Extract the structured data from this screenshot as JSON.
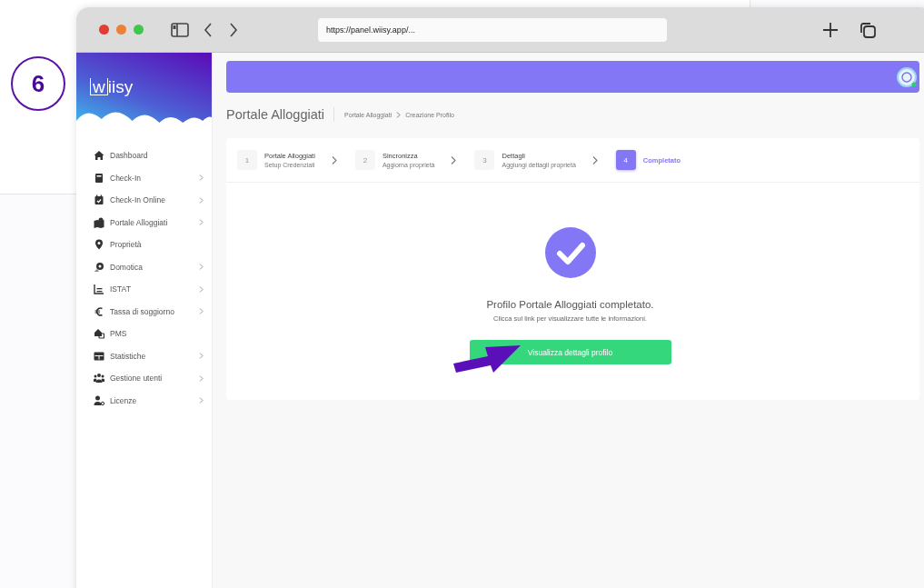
{
  "step_badge": "6",
  "browser": {
    "url": "https://panel.wiisy.app/..."
  },
  "logo": {
    "mark": "w",
    "text": "iisy"
  },
  "sidebar": {
    "items": [
      {
        "label": "Dashboard",
        "expandable": false
      },
      {
        "label": "Check-In",
        "expandable": true
      },
      {
        "label": "Check-In Online",
        "expandable": true
      },
      {
        "label": "Portale Alloggiati",
        "expandable": true
      },
      {
        "label": "Proprietà",
        "expandable": false
      },
      {
        "label": "Domotica",
        "expandable": true
      },
      {
        "label": "ISTAT",
        "expandable": true
      },
      {
        "label": "Tassa di soggiorno",
        "expandable": true
      },
      {
        "label": "PMS",
        "expandable": false
      },
      {
        "label": "Statistiche",
        "expandable": true
      },
      {
        "label": "Gestione utenti",
        "expandable": true
      },
      {
        "label": "Licenze",
        "expandable": true
      }
    ]
  },
  "page": {
    "title": "Portale Alloggiati",
    "breadcrumb": [
      "Portale Alloggiati",
      "Creazione Profilo"
    ]
  },
  "steps": [
    {
      "number": "1",
      "title": "Portale Alloggiati",
      "subtitle": "Setup Credenziali",
      "selected": false
    },
    {
      "number": "2",
      "title": "Sincronizza",
      "subtitle": "Aggiorna proprietà",
      "selected": false
    },
    {
      "number": "3",
      "title": "Dettagli",
      "subtitle": "Aggiungi dettagli proprietà",
      "selected": false
    },
    {
      "number": "4",
      "title": "Completato",
      "selected": true
    }
  ],
  "result": {
    "heading": "Profilo Portale Alloggiati completato.",
    "message": "Clicca sul link per visualizzare tutte le informazioni.",
    "button": "Visualizza dettagli profilo"
  }
}
